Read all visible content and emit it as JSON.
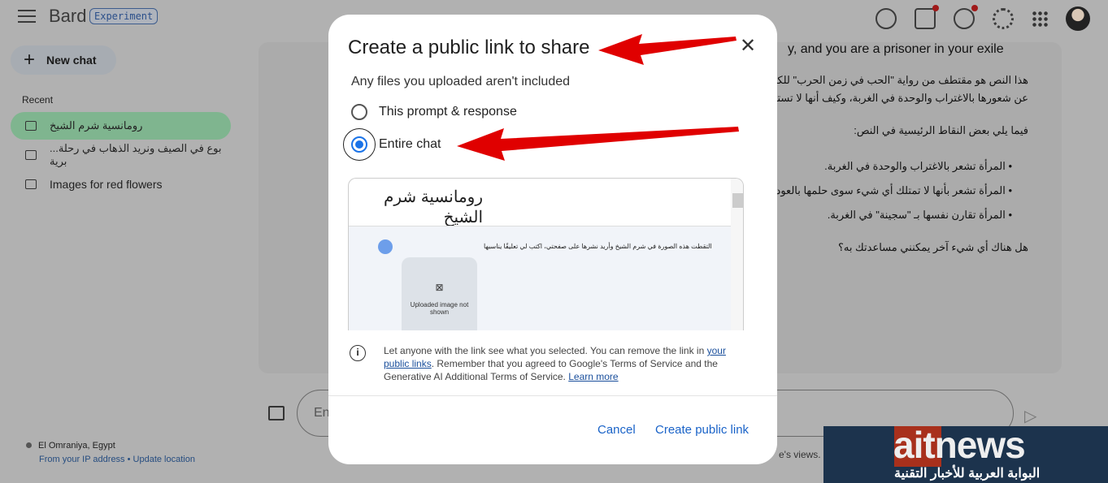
{
  "header": {
    "brand": "Bard",
    "badge": "Experiment",
    "icons": [
      "history-icon",
      "extension-icon",
      "help-icon",
      "settings-icon",
      "apps-grid-icon",
      "avatar"
    ]
  },
  "sidebar": {
    "new_chat": "New chat",
    "recent_label": "Recent",
    "chats": [
      {
        "label": "رومانسية شرم الشيخ",
        "selected": true
      },
      {
        "label": "...بوع في الصيف ونريد الذهاب في رحلة برية",
        "selected": false
      },
      {
        "label": "Images for red flowers",
        "selected": false
      }
    ],
    "location": "El Omraniya, Egypt",
    "from_ip": "From your IP address",
    "update_location": "Update location"
  },
  "response": {
    "heading": "y, and you are a prisoner in your exile",
    "p1": "هذا النص هو مقتطف من رواية \"الحب في زمن الحرب\" للكا",
    "p2": "عن شعورها بالاغتراب والوحدة في الغربة، وكيف أنها لا تستد",
    "p3": "فيما يلي بعض النقاط الرئيسية في النص:",
    "bullets": [
      "المرأة تشعر بالاغتراب والوحدة في الغربة.",
      "المرأة تشعر بأنها لا تمتلك أي شيء سوى حلمها بالعود",
      "المرأة تقارن نفسها بـ \"سجينة\" في الغربة."
    ],
    "p4": "هل هناك أي شيء آخر يمكنني مساعدتك به؟"
  },
  "input": {
    "placeholder": "En"
  },
  "footer": {
    "text": "e's views. B"
  },
  "dialog": {
    "title": "Create a public link to share",
    "subtitle": "Any files you uploaded aren't included",
    "options": [
      {
        "label": "This prompt & response",
        "selected": false
      },
      {
        "label": "Entire chat",
        "selected": true
      }
    ],
    "preview": {
      "title": "رومانسية شرم الشيخ",
      "message": "التقطت هذه الصورة في شرم الشيخ وأريد نشرها على صفحتي، اكتب لي تعليقًا يناسبها",
      "image_placeholder": "Uploaded image not shown"
    },
    "info_pre": "Let anyone with the link see what you selected. You can remove the link in ",
    "info_link1": "your public links",
    "info_mid": ". Remember that you agreed to Google's Terms of Service and the Generative AI Additional Terms of Service. ",
    "info_link2": "Learn more",
    "cancel": "Cancel",
    "create": "Create public link"
  },
  "watermark": {
    "text": "aitnews",
    "tagline": "البوابة العربية للأخبار التقنية"
  },
  "colors": {
    "accent": "#1a73e8",
    "arrow": "#e00000",
    "selected_chat": "#7fb58f"
  }
}
